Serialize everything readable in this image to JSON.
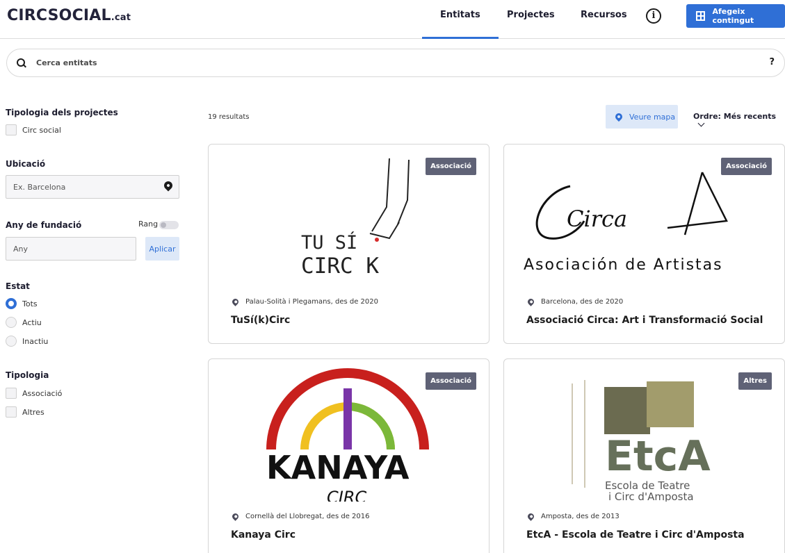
{
  "header": {
    "logo_main": "CIRCSOCIAL",
    "logo_suffix": ".cat",
    "tabs": [
      {
        "label": "Entitats",
        "active": true
      },
      {
        "label": "Projectes",
        "active": false
      },
      {
        "label": "Recursos",
        "active": false
      }
    ],
    "info_icon": "i",
    "add_button_label": "Afegeix contingut",
    "accent_color": "#2f6fd6"
  },
  "search": {
    "placeholder": "Cerca entitats",
    "help": "?"
  },
  "sidebar": {
    "project_typology": {
      "title": "Tipologia dels projectes",
      "options": [
        {
          "label": "Circ social",
          "checked": false
        }
      ]
    },
    "location": {
      "title": "Ubicació",
      "placeholder": "Ex. Barcelona"
    },
    "founding_year": {
      "title": "Any de fundació",
      "range_label": "Rang",
      "placeholder": "Any",
      "apply_label": "Aplicar"
    },
    "status": {
      "title": "Estat",
      "options": [
        {
          "label": "Tots",
          "selected": true
        },
        {
          "label": "Actiu",
          "selected": false
        },
        {
          "label": "Inactiu",
          "selected": false
        }
      ]
    },
    "typology": {
      "title": "Tipologia",
      "options": [
        {
          "label": "Associació",
          "checked": false
        },
        {
          "label": "Altres",
          "checked": false
        }
      ]
    }
  },
  "main": {
    "results_count": "19 resultats",
    "map_button_label": "Veure mapa",
    "order_label": "Ordre:",
    "order_value": "Més recents",
    "cards": [
      {
        "badge": "Associació",
        "location": "Palau-Solità i Plegamans, des de 2020",
        "title": "TuSí(k)Circ",
        "logo_lines": [
          "TU SÍ",
          "CIRC K"
        ]
      },
      {
        "badge": "Associació",
        "location": "Barcelona, des de 2020",
        "title": "Associació Circa: Art i Transformació Social",
        "logo_lines": [
          "Circa",
          "Asociación de Artistas"
        ]
      },
      {
        "badge": "Associació",
        "location": "Cornellà del Llobregat, des de 2016",
        "title": "Kanaya Circ",
        "logo_lines": [
          "KANAYA",
          "CIRC"
        ]
      },
      {
        "badge": "Altres",
        "location": "Amposta, des de 2013",
        "title": "EtcA - Escola de Teatre i Circ d'Amposta",
        "logo_lines": [
          "EtcA",
          "Escola de Teatre",
          "i Circ d'Amposta"
        ]
      }
    ]
  }
}
